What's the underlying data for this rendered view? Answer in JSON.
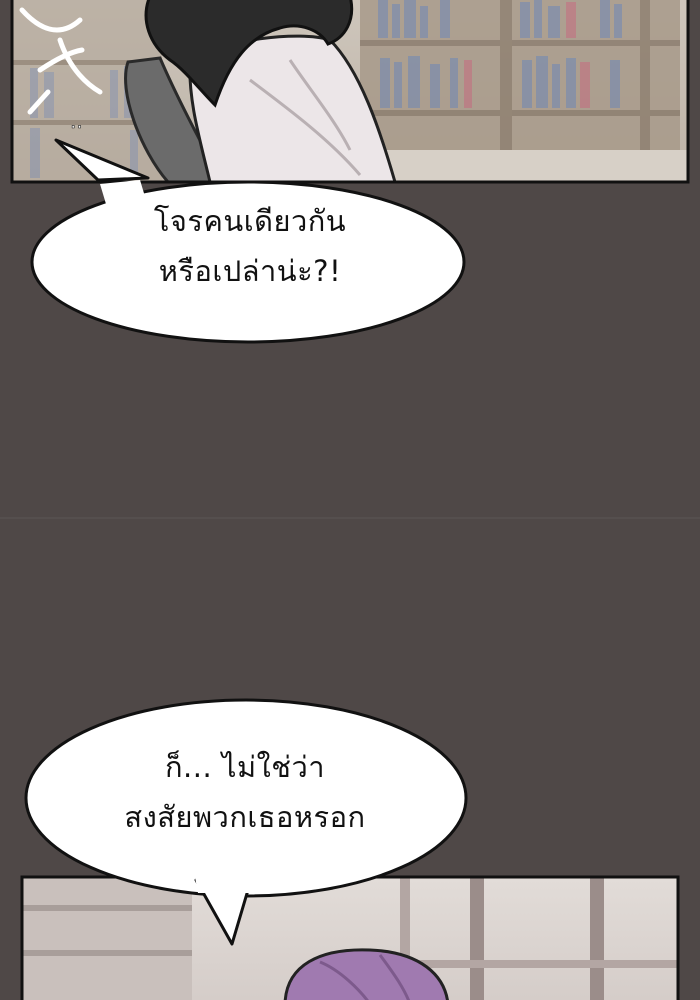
{
  "colors": {
    "background": "#4f4847",
    "bubble_fill": "#ffffff",
    "bubble_stroke": "#111111",
    "panel_frame": "#111111"
  },
  "panels": [
    {
      "position": "top",
      "scene": "library interior with bookshelves, character with dark hair in a chair",
      "sfx_text": "ซ…"
    },
    {
      "position": "bottom",
      "scene": "library interior with windows, character with purple hair"
    }
  ],
  "bubbles": [
    {
      "lines": [
        "โจรคนเดียวกัน",
        "หรือเปล่าน่ะ?!"
      ]
    },
    {
      "lines": [
        "ก็... ไม่ใช่ว่า",
        "สงสัยพวกเธอหรอก"
      ]
    }
  ]
}
